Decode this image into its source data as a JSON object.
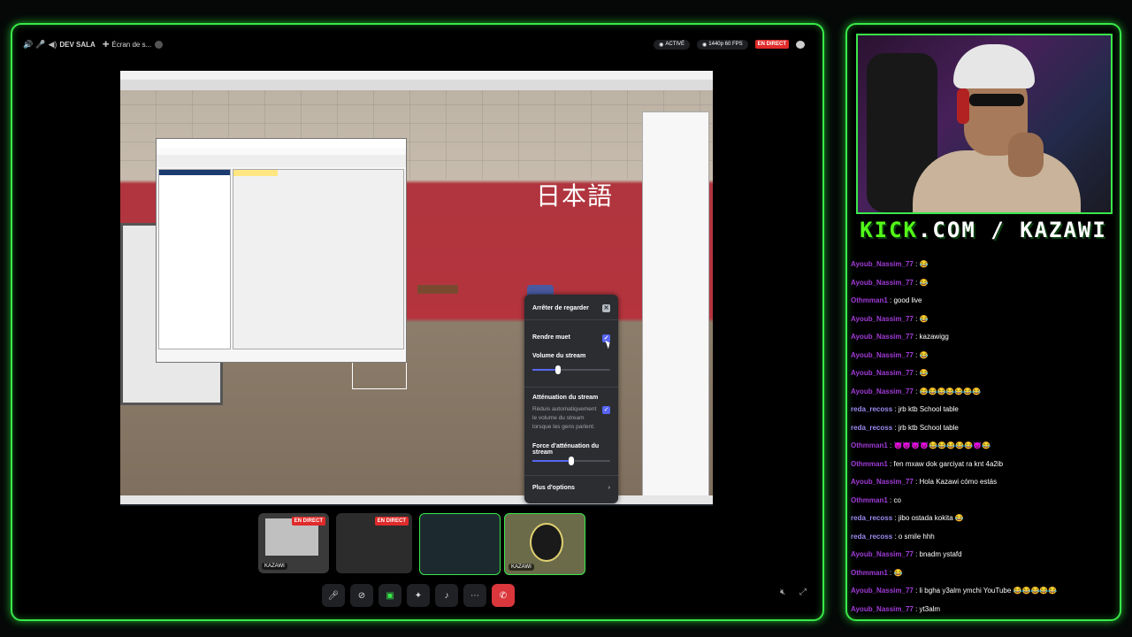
{
  "topbar": {
    "channel": "DEV SALA",
    "screen_share": "Écran de s...",
    "active": "ACTIVÉ",
    "quality": "1440p 60 FPS",
    "live": "EN DIRECT"
  },
  "scene": {
    "kanji": "日本語"
  },
  "menu": {
    "stop_watching": "Arrêter de regarder",
    "mute": "Rendre muet",
    "stream_volume": "Volume du stream",
    "stream_volume_level": 0.33,
    "attenuation": "Atténuation du stream",
    "attenuation_desc": "Réduis automatiquement le volume du stream lorsque les gens parlent.",
    "attenuation_strength": "Force d'atténuation du stream",
    "attenuation_strength_level": 0.5,
    "more_options": "Plus d'options"
  },
  "thumbnails": [
    {
      "label": "KAZAWI",
      "live": "EN DIRECT"
    },
    {
      "label": "",
      "live": "EN DIRECT"
    },
    {
      "label": "",
      "live": ""
    },
    {
      "label": "KAZAWI",
      "live": ""
    }
  ],
  "brand": {
    "kick": "KICK",
    "rest": ".COM / KAZAWI"
  },
  "chat": [
    {
      "user": "Ayoub_Nassim_77",
      "text": "😂",
      "color": "#a03bd6"
    },
    {
      "user": "Ayoub_Nassim_77",
      "text": "😂",
      "color": "#a03bd6"
    },
    {
      "user": "Othmman1",
      "text": "good live",
      "color": "#a03bd6"
    },
    {
      "user": "Ayoub_Nassim_77",
      "text": "😂",
      "color": "#a03bd6"
    },
    {
      "user": "Ayoub_Nassim_77",
      "text": "kazawigg",
      "color": "#a03bd6"
    },
    {
      "user": "Ayoub_Nassim_77",
      "text": "😂",
      "color": "#a03bd6"
    },
    {
      "user": "Ayoub_Nassim_77",
      "text": "😂",
      "color": "#a03bd6"
    },
    {
      "user": "Ayoub_Nassim_77",
      "text": "😂😂😂😂😂😂😂",
      "color": "#a03bd6"
    },
    {
      "user": "reda_recoss",
      "text": "jrb ktb School table",
      "color": "#9a8cf0"
    },
    {
      "user": "reda_recoss",
      "text": "jrb ktb School table",
      "color": "#9a8cf0"
    },
    {
      "user": "Othmman1",
      "text": "😈😈😈😈😂😂😂😂😂😈😂",
      "color": "#a03bd6"
    },
    {
      "user": "Othmman1",
      "text": "fen mxaw dok garciyat ra knt 4a2ib",
      "color": "#a03bd6"
    },
    {
      "user": "Ayoub_Nassim_77",
      "text": "Hola Kazawi cómo estás",
      "color": "#a03bd6"
    },
    {
      "user": "Othmman1",
      "text": "co",
      "color": "#a03bd6"
    },
    {
      "user": "reda_recoss",
      "text": "jibo ostada kokita 😂",
      "color": "#9a8cf0"
    },
    {
      "user": "reda_recoss",
      "text": "o smile hhh",
      "color": "#9a8cf0"
    },
    {
      "user": "Ayoub_Nassim_77",
      "text": "bnadm ystafd",
      "color": "#a03bd6"
    },
    {
      "user": "Othmman1",
      "text": "😂",
      "color": "#a03bd6"
    },
    {
      "user": "Ayoub_Nassim_77",
      "text": "li bgha y3alm ymchi YouTube 😂😂😂😂😂",
      "color": "#a03bd6"
    },
    {
      "user": "Ayoub_Nassim_77",
      "text": "yt3alm",
      "color": "#a03bd6"
    }
  ]
}
